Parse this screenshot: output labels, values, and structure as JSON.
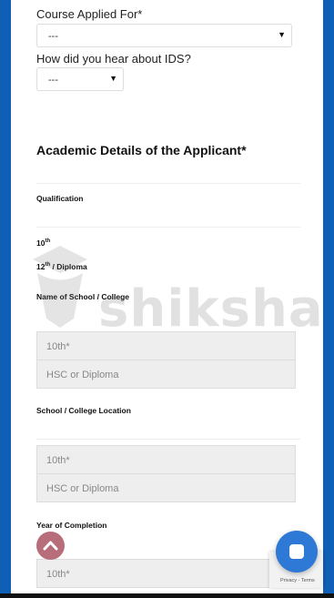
{
  "form": {
    "course_label": "Course Applied For*",
    "course_value": "---",
    "hear_label": "How did you hear about IDS?",
    "hear_value": "---",
    "academic_title": "Academic Details of the Applicant*",
    "qualification_label": "Qualification",
    "tenth_base": "10",
    "tenth_sup": "th",
    "twelfth_base": "12",
    "twelfth_sup": "th",
    "twelfth_suffix": " / Diploma",
    "school_label": "Name of School / College",
    "school_10th_placeholder": "10th*",
    "school_hsc_placeholder": "HSC or Diploma",
    "location_label": "School / College Location",
    "location_10th_placeholder": "10th*",
    "location_hsc_placeholder": "HSC or Diploma",
    "year_label": "Year of Completion",
    "year_10th_placeholder": "10th*"
  },
  "watermark": {
    "text": "shiksha"
  },
  "recaptcha": {
    "links": "Privacy - Terms"
  },
  "colors": {
    "frame": "#0e5fb5",
    "chat_button": "#2e78d6",
    "scroll_button": "#b76e7a"
  },
  "icons": {
    "caret": "triangle-down",
    "scroll_up": "chevron-up-icon",
    "chat": "chat-bubble-icon"
  }
}
